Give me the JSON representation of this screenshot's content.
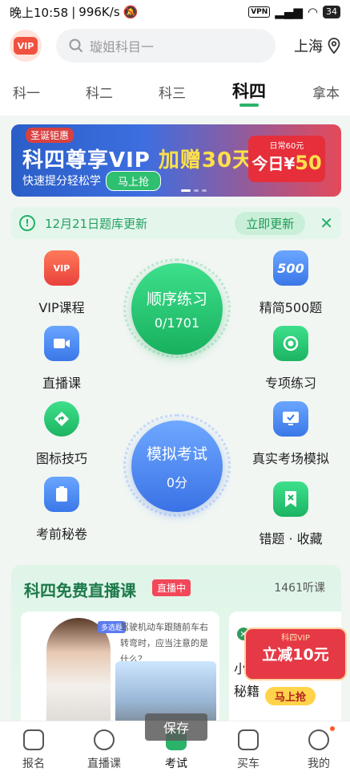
{
  "status_bar": {
    "time": "晚上10:58",
    "speed": "996K/s",
    "vpn": "VPN",
    "battery": "34"
  },
  "header": {
    "vip_logo": "VIP",
    "search_placeholder": "璇姐科目一",
    "city": "上海"
  },
  "tabs": [
    {
      "label": "科一"
    },
    {
      "label": "科二"
    },
    {
      "label": "科三"
    },
    {
      "label": "科四"
    },
    {
      "label": "拿本"
    }
  ],
  "banner": {
    "tag": "圣诞钜惠",
    "title_a": "科四尊享VIP",
    "title_b": "加赠30天",
    "sub": "快速提分轻松学",
    "button": "马上抢",
    "coupon_line1": "日常60元",
    "coupon_prefix": "今日¥",
    "coupon_value": "50"
  },
  "update_bar": {
    "text": "12月21日题库更新",
    "button": "立即更新",
    "close": "✕"
  },
  "features": {
    "vip": {
      "icon_text": "VIP",
      "label": "VIP课程"
    },
    "live": {
      "label": "直播课"
    },
    "signs": {
      "label": "图标技巧"
    },
    "secret": {
      "label": "考前秘卷"
    },
    "top500": {
      "icon_text": "500",
      "label": "精简500题"
    },
    "special": {
      "label": "专项练习"
    },
    "real": {
      "label": "真实考场模拟"
    },
    "wrong": {
      "label": "错题 · 收藏"
    }
  },
  "practice": {
    "title": "顺序练习",
    "progress": "0/1701"
  },
  "exam": {
    "title": "模拟考试",
    "score": "0分"
  },
  "live_section": {
    "title": "科四免费直播课",
    "badge": "直播中",
    "listeners": "1461听课",
    "card_tag": "多选题",
    "card_question": "驾驶机动车跟随前车右转弯时，应当注意的是什么？",
    "side_text": "小\n秘籍"
  },
  "promo": {
    "line1": "科四VIP",
    "line2": "立减10元",
    "button": "马上抢"
  },
  "save_tip": "保存",
  "bottom_nav": [
    {
      "label": "报名"
    },
    {
      "label": "直播课"
    },
    {
      "label": "考试"
    },
    {
      "label": "买车"
    },
    {
      "label": "我的"
    }
  ],
  "colors": {
    "accent": "#2bb36a",
    "vip_red": "#f0523f",
    "blue": "#3a77e8"
  }
}
